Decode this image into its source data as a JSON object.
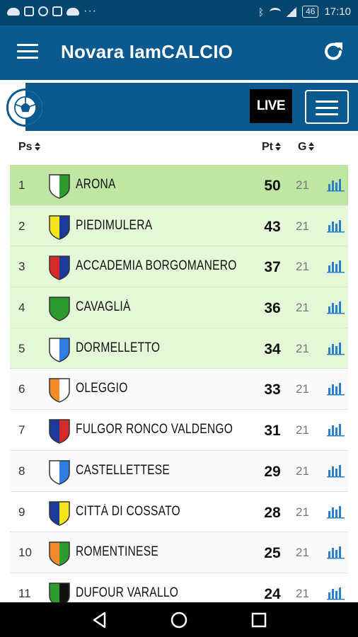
{
  "status_bar": {
    "network_badge": "46",
    "time": "17:10",
    "left_icons": [
      "cloud-icon",
      "instagram-icon",
      "whatsapp-icon",
      "gallery-icon",
      "cloud-icon",
      "more-icon"
    ],
    "right_icons": [
      "bluetooth-icon",
      "wifi-icon",
      "signal-icon",
      "battery-icon"
    ]
  },
  "app_bar": {
    "title": "Novara IamCALCIO",
    "menu_icon": "hamburger-menu-icon",
    "refresh_icon": "refresh-icon"
  },
  "toolbar": {
    "live_label": "LIVE",
    "list_icon": "list-menu-icon",
    "logo_icon": "soccer-ball-icon"
  },
  "table": {
    "headers": {
      "position": "Ps",
      "points": "Pt",
      "games": "G"
    },
    "rows": [
      {
        "pos": "1",
        "team": "ARONA",
        "pts": "50",
        "games": "21",
        "shield": [
          "#ffffff",
          "#2e9b2e",
          "#2e9b2e"
        ]
      },
      {
        "pos": "2",
        "team": "PIEDIMULERA",
        "pts": "43",
        "games": "21",
        "shield": [
          "#f4e51a",
          "#1c3a9c"
        ]
      },
      {
        "pos": "3",
        "team": "ACCADEMIA BORGOMANERO",
        "pts": "37",
        "games": "21",
        "shield": [
          "#d92a2a",
          "#1c3a9c"
        ]
      },
      {
        "pos": "4",
        "team": "CAVAGLIÀ",
        "pts": "36",
        "games": "21",
        "shield": [
          "#2e9b2e",
          "#2e9b2e"
        ]
      },
      {
        "pos": "5",
        "team": "DORMELLETTO",
        "pts": "34",
        "games": "21",
        "shield": [
          "#ffffff",
          "#2f7de0"
        ]
      },
      {
        "pos": "6",
        "team": "OLEGGIO",
        "pts": "33",
        "games": "21",
        "shield": [
          "#f08a2a",
          "#ffffff"
        ]
      },
      {
        "pos": "7",
        "team": "FULGOR RONCO VALDENGO",
        "pts": "31",
        "games": "21",
        "shield": [
          "#1c3a9c",
          "#d92a2a"
        ]
      },
      {
        "pos": "8",
        "team": "CASTELLETTESE",
        "pts": "29",
        "games": "21",
        "shield": [
          "#ffffff",
          "#2f7de0"
        ]
      },
      {
        "pos": "9",
        "team": "CITTÀ DI COSSATO",
        "pts": "28",
        "games": "21",
        "shield": [
          "#1c3a9c",
          "#f4e51a"
        ]
      },
      {
        "pos": "10",
        "team": "ROMENTINESE",
        "pts": "25",
        "games": "21",
        "shield": [
          "#f08a2a",
          "#2e9b2e"
        ]
      },
      {
        "pos": "11",
        "team": "DUFOUR VARALLO",
        "pts": "24",
        "games": "21",
        "shield": [
          "#2e9b2e",
          "#111111"
        ]
      }
    ],
    "highlight": {
      "leader_color": "#bfe6a2",
      "promotion_color": "#e4f7d6",
      "promotion_rows": 5
    },
    "stats_icon": "bar-chart-icon"
  },
  "colors": {
    "status_bar": "#06456e",
    "app_bar": "#0a5a8f",
    "accent_link": "#2a7fcf"
  },
  "nav_bar": {
    "icons": [
      "back-nav-icon",
      "home-nav-icon",
      "recents-nav-icon"
    ]
  }
}
